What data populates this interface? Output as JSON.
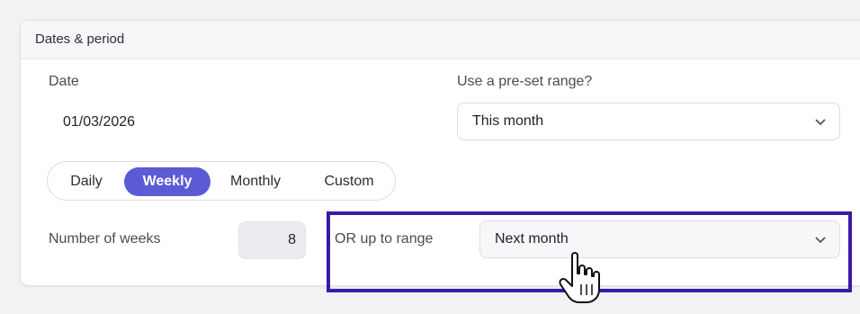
{
  "section": {
    "title": "Dates & period"
  },
  "date": {
    "label": "Date",
    "value": "01/03/2026"
  },
  "preset": {
    "label": "Use a pre-set range?",
    "value": "This month"
  },
  "period_tabs": [
    {
      "label": "Daily",
      "active": false
    },
    {
      "label": "Weekly",
      "active": true
    },
    {
      "label": "Monthly",
      "active": false
    },
    {
      "label": "Custom",
      "active": false
    }
  ],
  "weeks": {
    "label": "Number of weeks",
    "value": "8"
  },
  "range": {
    "label": "OR up to range",
    "value": "Next month"
  },
  "colors": {
    "accent": "#5b5bd6",
    "highlight": "#3b1aa8"
  },
  "icons": {
    "dropdown": "chevron-down-icon",
    "cursor": "hand-pointer-icon"
  }
}
